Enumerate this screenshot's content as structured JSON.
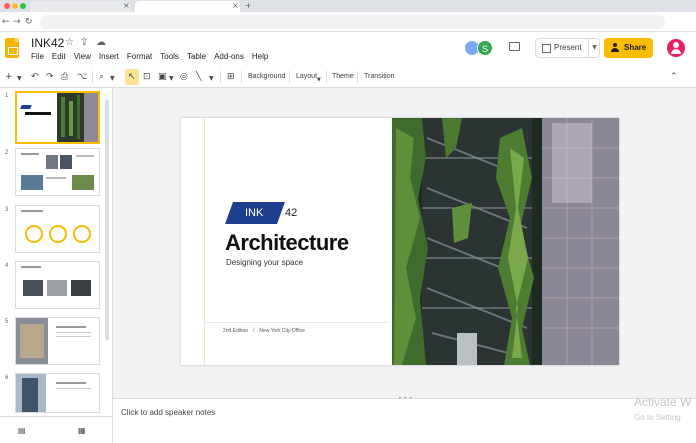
{
  "app": {
    "doc_title": "INK42",
    "menu": [
      "File",
      "Edit",
      "View",
      "Insert",
      "Format",
      "Tools",
      "Table",
      "Add-ons",
      "Help"
    ],
    "present_label": "Present",
    "share_label": "Share",
    "collaborator_initial": "S"
  },
  "toolbar": {
    "background_label": "Background",
    "layout_label": "Layout",
    "theme_label": "Theme",
    "transition_label": "Transition"
  },
  "filmstrip": {
    "slides": [
      {
        "num": "1"
      },
      {
        "num": "2"
      },
      {
        "num": "3"
      },
      {
        "num": "4"
      },
      {
        "num": "5"
      },
      {
        "num": "6"
      }
    ],
    "thumb1_title": "Architecture"
  },
  "slide": {
    "badge": "INK",
    "badge_num": "42",
    "title": "Architecture",
    "subtitle": "Designing your space",
    "edition": "2nd Edition",
    "separator": "/",
    "office": "New York City Office"
  },
  "notes": {
    "placeholder": "Click to add speaker notes"
  },
  "watermark": {
    "line1": "Activate W",
    "line2": "Go to Setting"
  },
  "colors": {
    "accent_yellow": "#fbbc04",
    "brand_blue": "#1d3f8e",
    "account_pink": "#e91e63"
  }
}
